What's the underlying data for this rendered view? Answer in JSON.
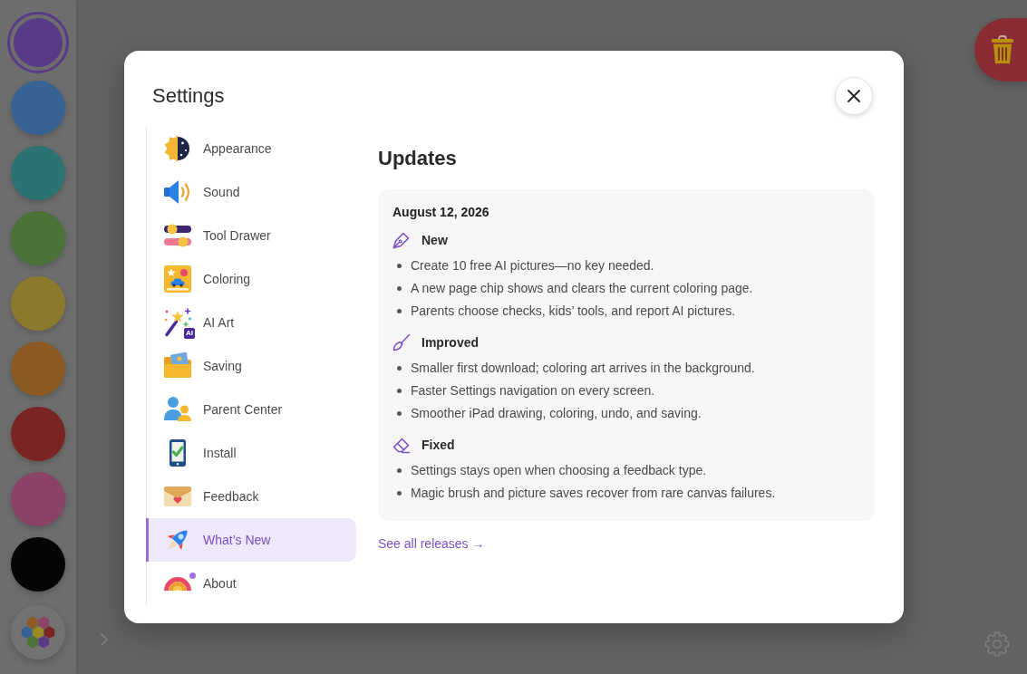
{
  "palette": {
    "swatches": [
      {
        "color": "#583b87",
        "selected": true
      },
      {
        "color": "#376394",
        "selected": false
      },
      {
        "color": "#2b7272",
        "selected": false
      },
      {
        "color": "#4a7136",
        "selected": false
      },
      {
        "color": "#8c7a2c",
        "selected": false
      },
      {
        "color": "#8a5a22",
        "selected": false
      },
      {
        "color": "#7a2424",
        "selected": false
      },
      {
        "color": "#8a4266",
        "selected": false
      },
      {
        "color": "#050505",
        "selected": false
      }
    ]
  },
  "dialog": {
    "title": "Settings",
    "nav": [
      {
        "label": "Appearance",
        "selected": false,
        "notification_dot": false
      },
      {
        "label": "Sound",
        "selected": false,
        "notification_dot": false
      },
      {
        "label": "Tool Drawer",
        "selected": false,
        "notification_dot": false
      },
      {
        "label": "Coloring",
        "selected": false,
        "notification_dot": false
      },
      {
        "label": "AI Art",
        "selected": false,
        "notification_dot": false,
        "icon_badge": "AI"
      },
      {
        "label": "Saving",
        "selected": false,
        "notification_dot": false
      },
      {
        "label": "Parent Center",
        "selected": false,
        "notification_dot": false
      },
      {
        "label": "Install",
        "selected": false,
        "notification_dot": false
      },
      {
        "label": "Feedback",
        "selected": false,
        "notification_dot": false
      },
      {
        "label": "What’s New",
        "selected": true,
        "notification_dot": false
      },
      {
        "label": "About",
        "selected": false,
        "notification_dot": true
      }
    ],
    "heading": "Updates",
    "release": {
      "date": "August 12, 2026",
      "sections": [
        {
          "title": "New",
          "items": [
            "Create 10 free AI pictures—no key needed.",
            "A new page chip shows and clears the current coloring page.",
            "Parents choose checks, kids’ tools, and report AI pictures."
          ]
        },
        {
          "title": "Improved",
          "items": [
            "Smaller first download; coloring art arrives in the background.",
            "Faster Settings navigation on every screen.",
            "Smoother iPad drawing, coloring, undo, and saving."
          ]
        },
        {
          "title": "Fixed",
          "items": [
            "Settings stays open when choosing a feedback type.",
            "Magic brush and picture saves recover from rare canvas failures."
          ]
        }
      ]
    },
    "link": "See all releases →"
  }
}
